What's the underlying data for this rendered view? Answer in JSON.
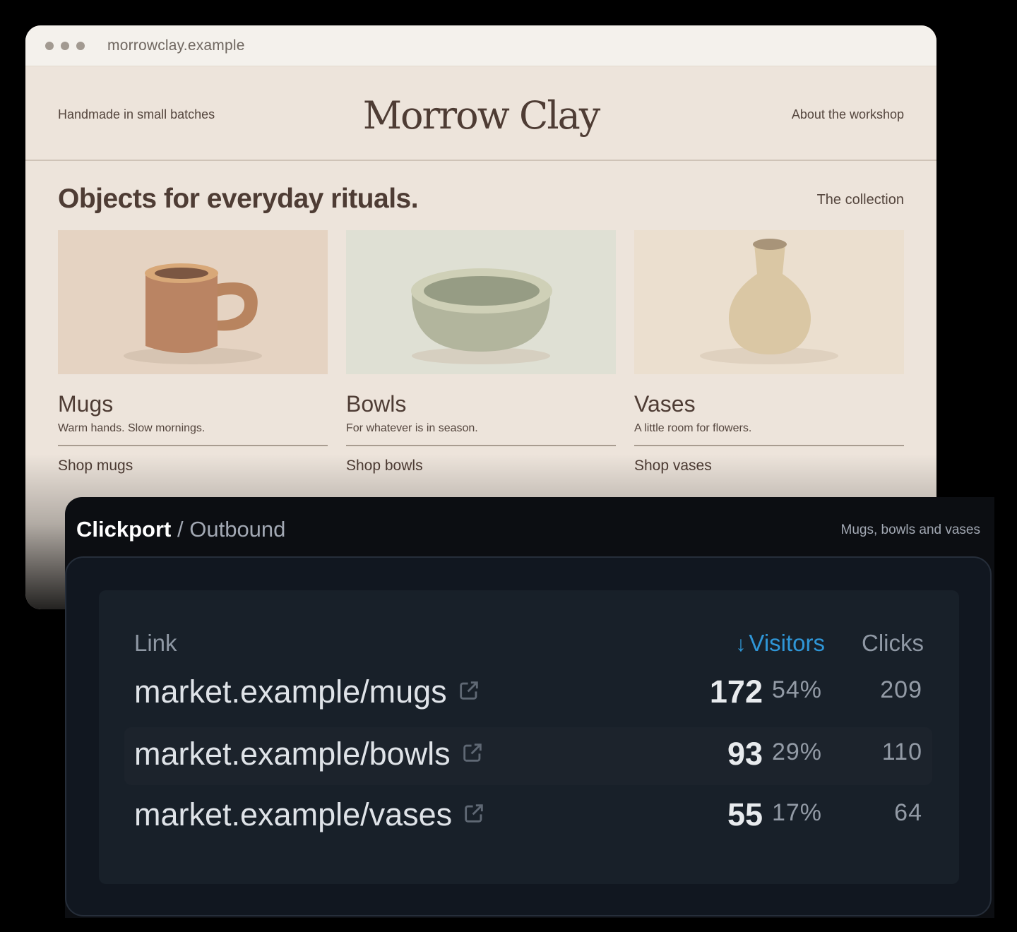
{
  "browser": {
    "url": "morrowclay.example",
    "header": {
      "tagline": "Handmade in small batches",
      "logo": "Morrow Clay",
      "about_link": "About the workshop"
    },
    "hero": {
      "title": "Objects for everyday rituals.",
      "collection_link": "The collection"
    },
    "cards": [
      {
        "title": "Mugs",
        "description": "Warm hands. Slow mornings.",
        "link": "Shop mugs",
        "icon": "mug-icon"
      },
      {
        "title": "Bowls",
        "description": "For whatever is in season.",
        "link": "Shop bowls",
        "icon": "bowl-icon"
      },
      {
        "title": "Vases",
        "description": "A little room for flowers.",
        "link": "Shop vases",
        "icon": "vase-icon"
      }
    ]
  },
  "panel": {
    "brand": "Clickport",
    "separator": "/",
    "section": "Outbound",
    "subtitle": "Mugs, bowls and vases",
    "table": {
      "headers": {
        "link": "Link",
        "visitors_arrow": "↓",
        "visitors": "Visitors",
        "clicks": "Clicks"
      },
      "rows": [
        {
          "link": "market.example/mugs",
          "visitors": "172",
          "percent": "54%",
          "clicks": "209"
        },
        {
          "link": "market.example/bowls",
          "visitors": "93",
          "percent": "29%",
          "clicks": "110"
        },
        {
          "link": "market.example/vases",
          "visitors": "55",
          "percent": "17%",
          "clicks": "64"
        }
      ]
    }
  },
  "colors": {
    "page_bg": "#ede4db",
    "text_brown": "#4e3c34",
    "panel_bg": "#0c0e12",
    "accent_blue": "#2f96d7"
  }
}
